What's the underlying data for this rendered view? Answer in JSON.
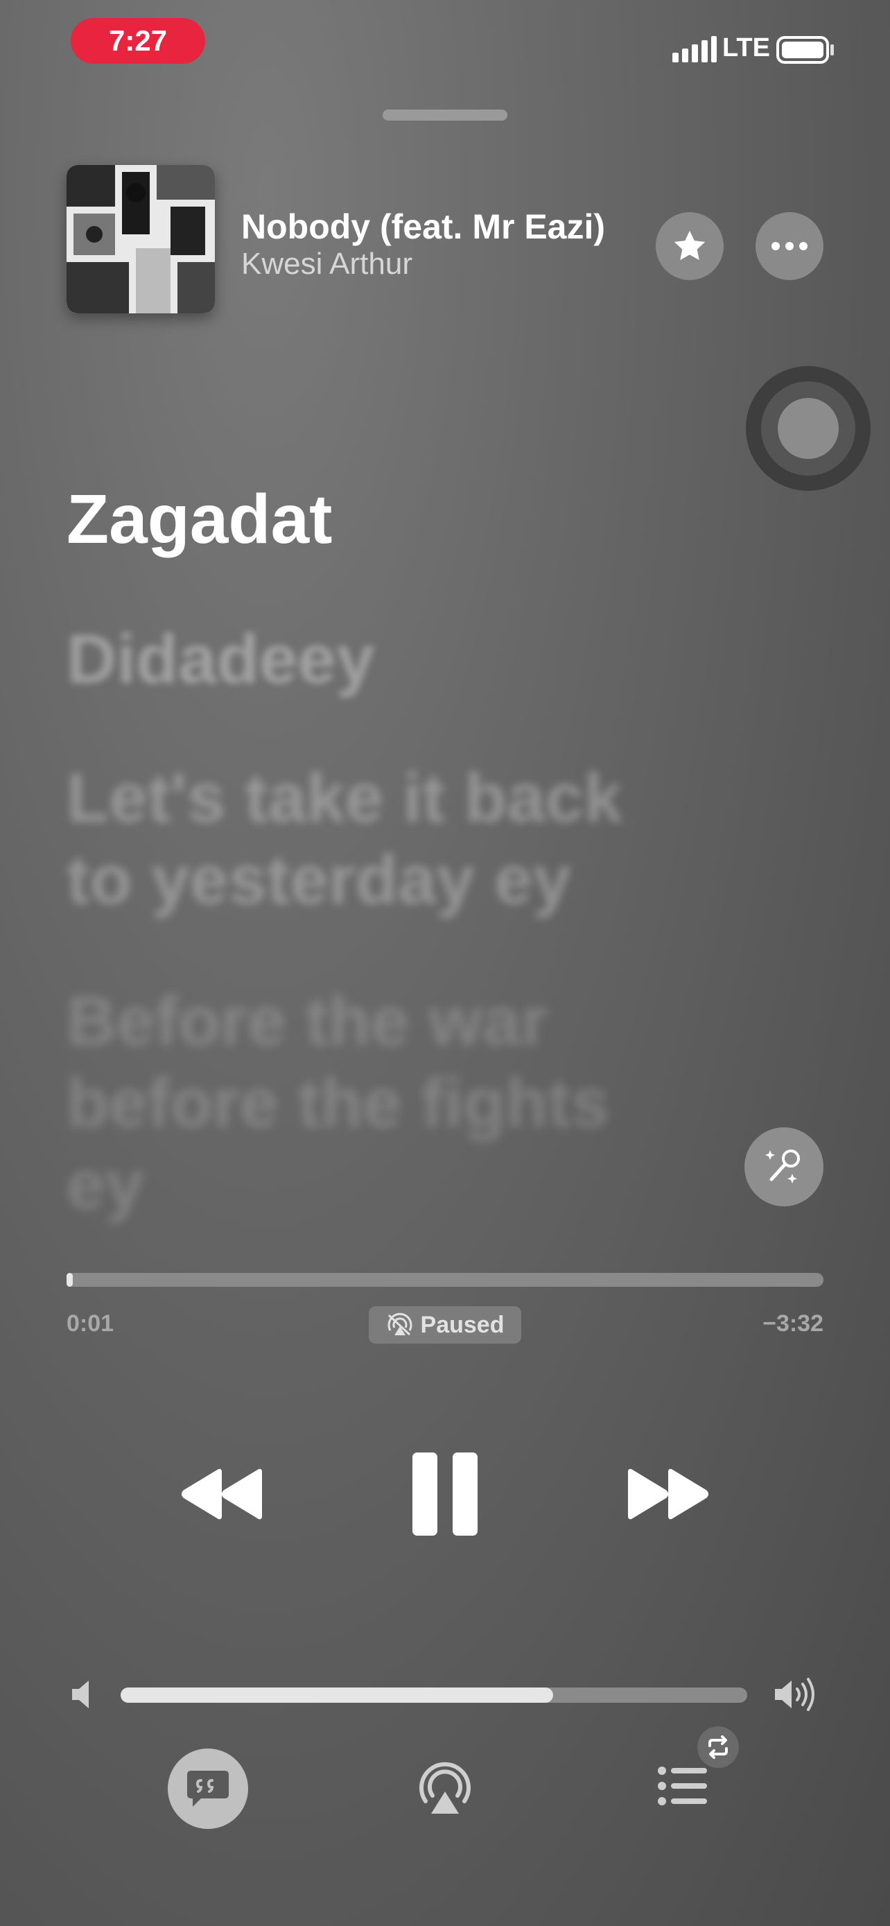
{
  "status_bar": {
    "time": "7:27",
    "network": "LTE",
    "accent_color": "#e8243f",
    "icons": [
      "signal-icon",
      "battery-icon"
    ]
  },
  "now_playing": {
    "title": "Nobody (feat. Mr Eazi)",
    "artist": "Kwesi Arthur",
    "actions": [
      "star-icon",
      "more-icon"
    ]
  },
  "lyrics": {
    "current_line": "Zagadat",
    "upcoming": [
      "Didadeey",
      "Let's take it back to yesterday ey",
      "Before the war before the fights ey"
    ]
  },
  "progress": {
    "elapsed": "0:01",
    "remaining": "−3:32",
    "fraction": 0.005,
    "state_label": "Paused"
  },
  "volume": {
    "fraction": 0.69
  },
  "toolbar": {
    "buttons": [
      "lyrics-icon",
      "airplay-icon",
      "queue-icon"
    ],
    "queue_badge": "repeat-icon"
  }
}
